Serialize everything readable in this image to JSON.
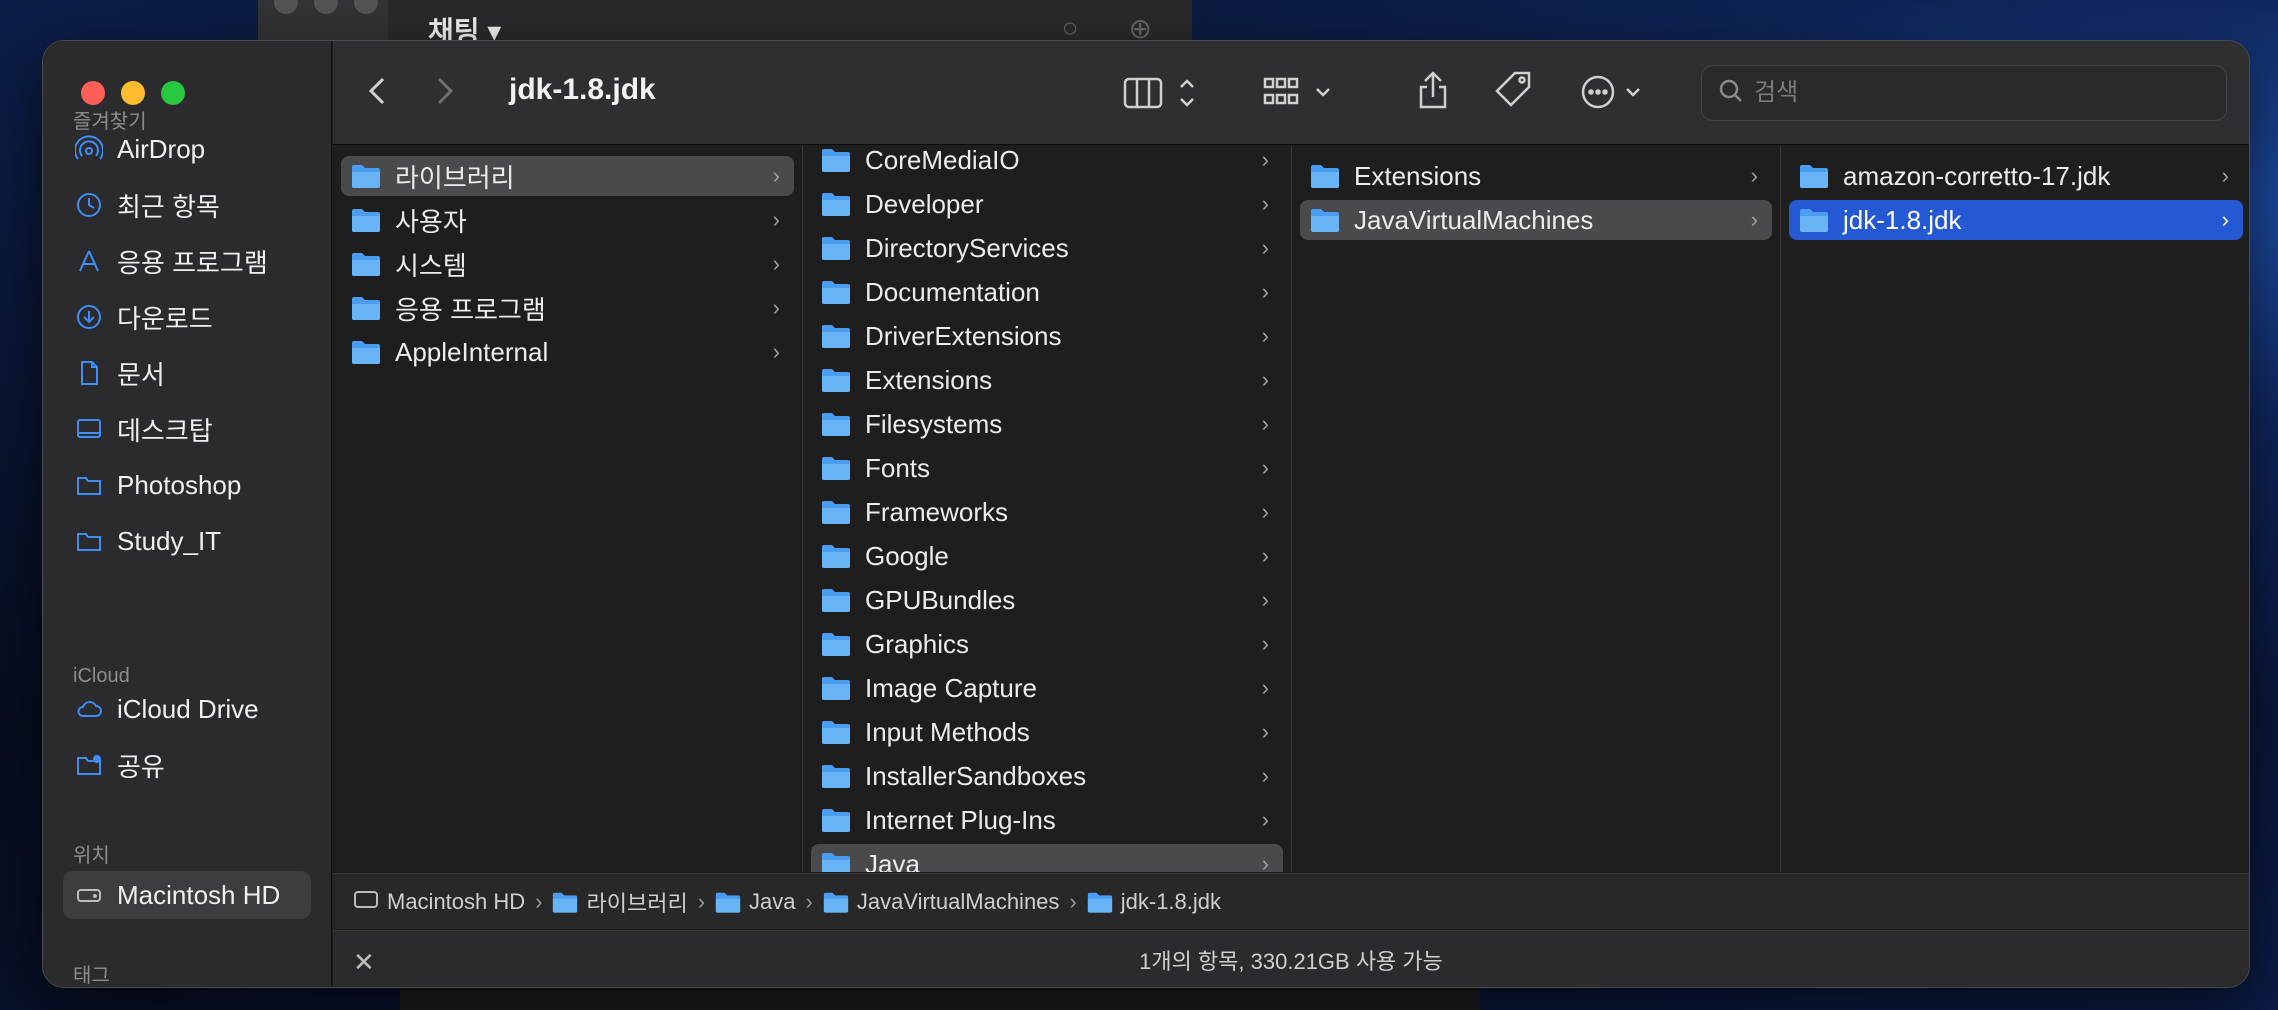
{
  "background_window": {
    "title": "채팅"
  },
  "window": {
    "title": "jdk-1.8.jdk"
  },
  "sidebar": {
    "sections": [
      {
        "label": "즐겨찾기"
      },
      {
        "label": "iCloud"
      },
      {
        "label": "위치"
      },
      {
        "label": "태그"
      }
    ],
    "favorites": [
      {
        "label": "AirDrop",
        "icon": "airdrop-icon"
      },
      {
        "label": "최근 항목",
        "icon": "clock-icon"
      },
      {
        "label": "응용 프로그램",
        "icon": "applications-icon"
      },
      {
        "label": "다운로드",
        "icon": "download-icon"
      },
      {
        "label": "문서",
        "icon": "document-icon"
      },
      {
        "label": "데스크탑",
        "icon": "desktop-icon"
      },
      {
        "label": "Photoshop",
        "icon": "folder-icon"
      },
      {
        "label": "Study_IT",
        "icon": "folder-icon"
      }
    ],
    "icloud": [
      {
        "label": "iCloud Drive",
        "icon": "cloud-icon"
      },
      {
        "label": "공유",
        "icon": "shared-folder-icon"
      }
    ],
    "locations": [
      {
        "label": "Macintosh HD",
        "icon": "drive-icon",
        "selected": true
      }
    ]
  },
  "toolbar": {
    "back": "back-icon",
    "forward": "forward-icon",
    "view": "column-view-icon",
    "group": "group-icon",
    "share": "share-icon",
    "tag": "tag-icon",
    "more": "more-icon"
  },
  "search": {
    "placeholder": "검색",
    "value": ""
  },
  "columns": [
    {
      "items": [
        {
          "label": "라이브러리",
          "selected": "gray"
        },
        {
          "label": "사용자"
        },
        {
          "label": "시스템"
        },
        {
          "label": "응용 프로그램"
        },
        {
          "label": "AppleInternal"
        }
      ]
    },
    {
      "items": [
        {
          "label": "CoreMediaIO"
        },
        {
          "label": "Developer"
        },
        {
          "label": "DirectoryServices"
        },
        {
          "label": "Documentation"
        },
        {
          "label": "DriverExtensions"
        },
        {
          "label": "Extensions"
        },
        {
          "label": "Filesystems"
        },
        {
          "label": "Fonts"
        },
        {
          "label": "Frameworks"
        },
        {
          "label": "Google"
        },
        {
          "label": "GPUBundles"
        },
        {
          "label": "Graphics"
        },
        {
          "label": "Image Capture"
        },
        {
          "label": "Input Methods"
        },
        {
          "label": "InstallerSandboxes"
        },
        {
          "label": "Internet Plug-Ins"
        },
        {
          "label": "Java",
          "selected": "gray"
        }
      ]
    },
    {
      "items": [
        {
          "label": "Extensions"
        },
        {
          "label": "JavaVirtualMachines",
          "selected": "gray"
        }
      ]
    },
    {
      "items": [
        {
          "label": "amazon-corretto-17.jdk"
        },
        {
          "label": "jdk-1.8.jdk",
          "selected": "blue"
        }
      ]
    }
  ],
  "pathbar": [
    "Macintosh HD",
    "라이브러리",
    "Java",
    "JavaVirtualMachines",
    "jdk-1.8.jdk"
  ],
  "status": {
    "text": "1개의 항목, 330.21GB 사용 가능"
  },
  "colors": {
    "accent": "#2459d3",
    "folder": "#5aa9f5",
    "close": "#ff5f57",
    "minimize": "#febc2e",
    "maximize": "#28c840"
  }
}
